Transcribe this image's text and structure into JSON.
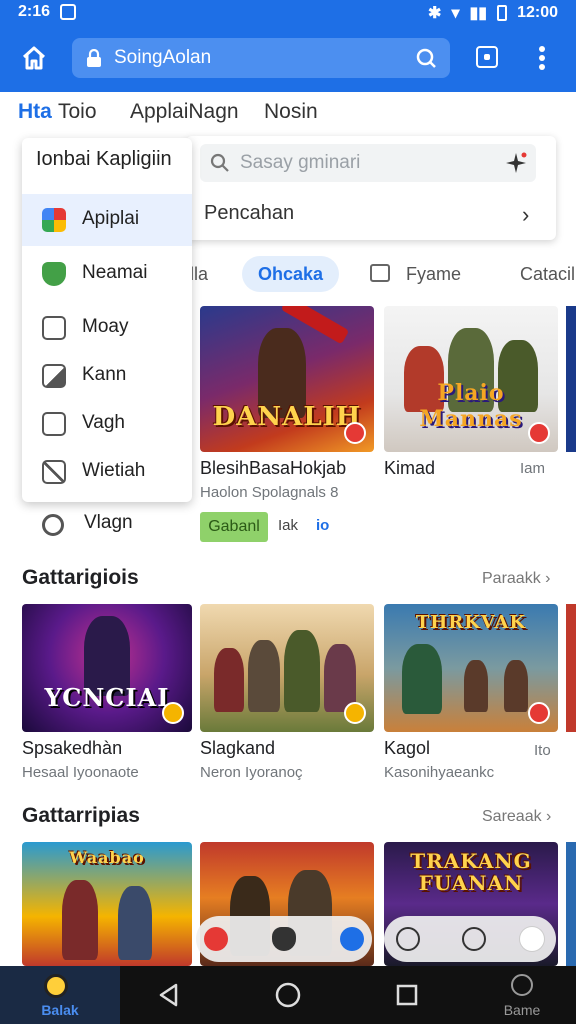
{
  "status": {
    "time": "2:16",
    "clock": "12:00"
  },
  "toolbar": {
    "url": "SoingAolan"
  },
  "nav": {
    "brand": "Hta",
    "items": [
      "Toio",
      "ApplaiNagn",
      "Nosin"
    ]
  },
  "search": {
    "placeholder": "Sasay gminari",
    "row_label": "Pencahan",
    "chevron": "›"
  },
  "menu": {
    "title": "Ionbai Kapligiin",
    "items": [
      {
        "label": "Apiplai",
        "icon": "app-grid-icon",
        "color": "#1e88e5"
      },
      {
        "label": "Neamai",
        "icon": "shield-icon",
        "color": "#43a047"
      },
      {
        "label": "Moay",
        "icon": "list-icon",
        "color": "#555555"
      },
      {
        "label": "Kann",
        "icon": "image-icon",
        "color": "#555555"
      },
      {
        "label": "Vagh",
        "icon": "square-icon",
        "color": "#555555"
      },
      {
        "label": "Wietiah",
        "icon": "box-icon",
        "color": "#555555"
      }
    ],
    "outside_item": "Vlagn"
  },
  "chips": [
    "lla",
    "Ohcaka",
    "Fyame",
    "Catacil"
  ],
  "featured": [
    {
      "name": "BlesihBasaHokjab",
      "sub": "Haolon Spolagnals",
      "sub_extra": "8",
      "art_text": "DANALIH"
    },
    {
      "name": "Kimad",
      "sub": "",
      "extra": "Iam",
      "art_text": "Plaio Mannas"
    }
  ],
  "install": {
    "label": "Gabanl",
    "a": "Iak",
    "b": "io"
  },
  "section1": {
    "title": "Gattarigiois",
    "link": "Paraakk ›"
  },
  "row1": [
    {
      "name": "Spsakedhàn",
      "sub": "Hesaal Iyoonaote",
      "art_text": "YCNCIAI"
    },
    {
      "name": "Slagkand",
      "sub": "Neron Iyoranoç",
      "art_text": ""
    },
    {
      "name": "Kagol",
      "sub": "Kasonihyaeankc",
      "extra": "Ito",
      "art_text": "THRKVAK"
    }
  ],
  "section2": {
    "title": "Gattarripias",
    "link": "Sareaak ›"
  },
  "row2": [
    {
      "art_text": "Waabao"
    },
    {
      "art_text": ""
    },
    {
      "art_text": "TRAKANG FUANAN"
    }
  ],
  "bottom": {
    "left_label": "Balak",
    "right_label": "Bame"
  },
  "colors": {
    "accent": "#1e6fe6",
    "install": "#8fd16a"
  }
}
